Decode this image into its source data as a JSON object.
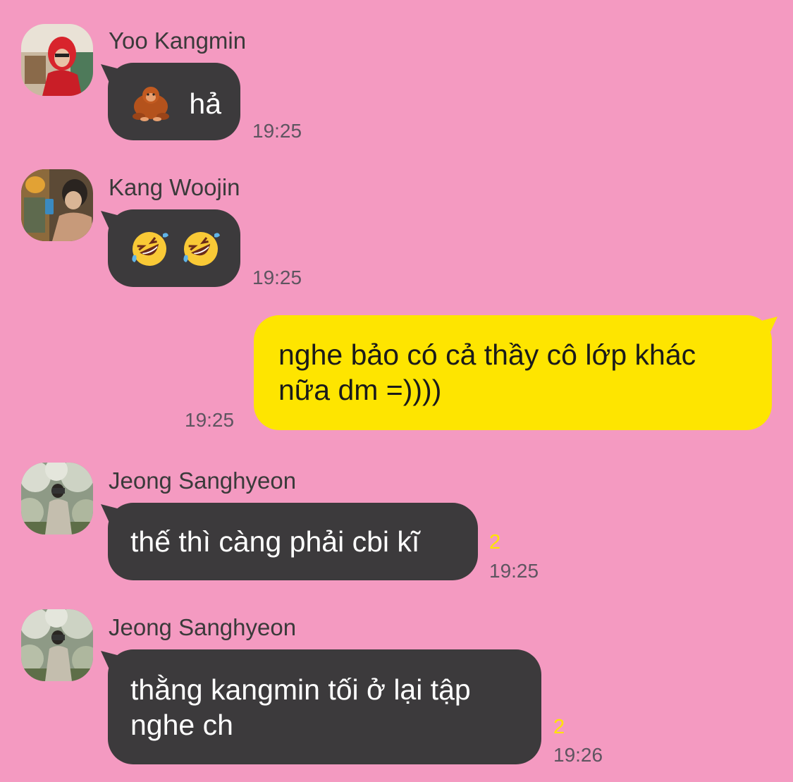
{
  "theme": {
    "background": "#F49AC1",
    "incoming_bubble": "#3C3A3C",
    "outgoing_bubble": "#FEE500",
    "unread_color": "#FEE500"
  },
  "messages": [
    {
      "sender": "Yoo Kangmin",
      "avatar_icon": "avatar-photo-red-hoodie",
      "emoji": "orangutan-emoji",
      "text": "hả",
      "time": "19:25"
    },
    {
      "sender": "Kang Woojin",
      "avatar_icon": "avatar-photo-phone-selfie",
      "emoji": "rolling-on-floor-laughing-emoji",
      "text": "",
      "time": "19:25"
    },
    {
      "sender": "",
      "outgoing": true,
      "lines": [
        "nghe bảo có cả thầy cô lớp khác",
        "nữa dm =))))"
      ],
      "time": "19:25"
    },
    {
      "sender": "Jeong Sanghyeon",
      "avatar_icon": "avatar-photo-tree-blossoms",
      "text": "thế thì càng phải cbi kĩ",
      "unread": "2",
      "time": "19:25"
    },
    {
      "sender": "Jeong Sanghyeon",
      "avatar_icon": "avatar-photo-tree-blossoms",
      "lines": [
        "thằng kangmin tối ở lại tập",
        "nghe ch"
      ],
      "unread": "2",
      "time": "19:26"
    }
  ]
}
